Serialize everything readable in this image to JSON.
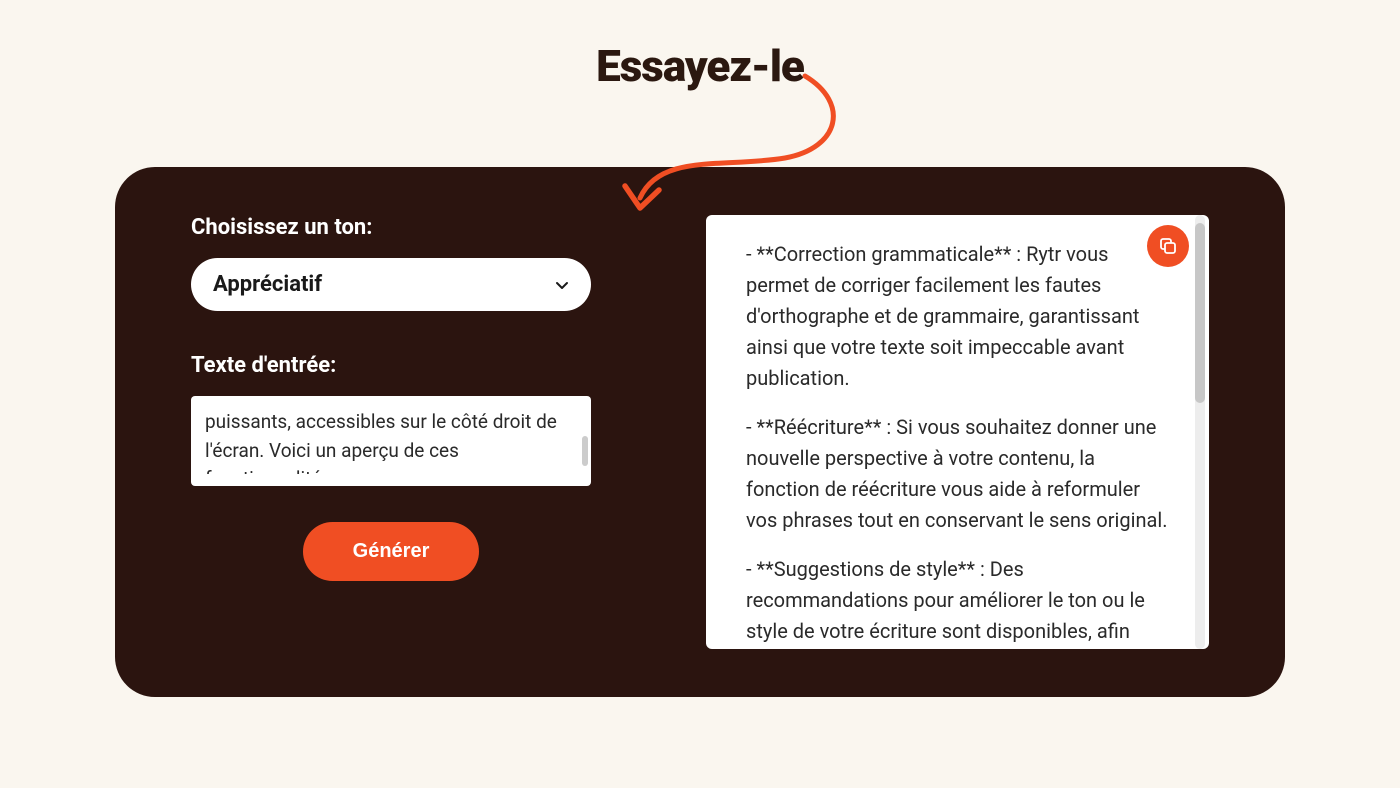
{
  "header": {
    "title": "Essayez-le"
  },
  "form": {
    "tone_label": "Choisissez un ton:",
    "tone_value": "Appréciatif",
    "input_label": "Texte d'entrée:",
    "input_value": "puissants, accessibles sur le côté droit de l'écran. Voici un aperçu de ces fonctionnalités :",
    "generate_label": "Générer"
  },
  "output": {
    "paragraphs": [
      "- **Correction grammaticale** : Rytr vous permet de corriger facilement les fautes d'orthographe et de grammaire, garantissant ainsi que votre texte soit impeccable avant publication.",
      "- **Réécriture** : Si vous souhaitez donner une nouvelle perspective à votre contenu, la fonction de réécriture vous aide à reformuler vos phrases tout en conservant le sens original.",
      "- **Suggestions de style** : Des recommandations pour améliorer le ton ou le style de votre écriture sont disponibles, afin"
    ]
  },
  "colors": {
    "accent": "#f04e23",
    "panel_bg": "#2b140f",
    "page_bg": "#faf6ef"
  }
}
